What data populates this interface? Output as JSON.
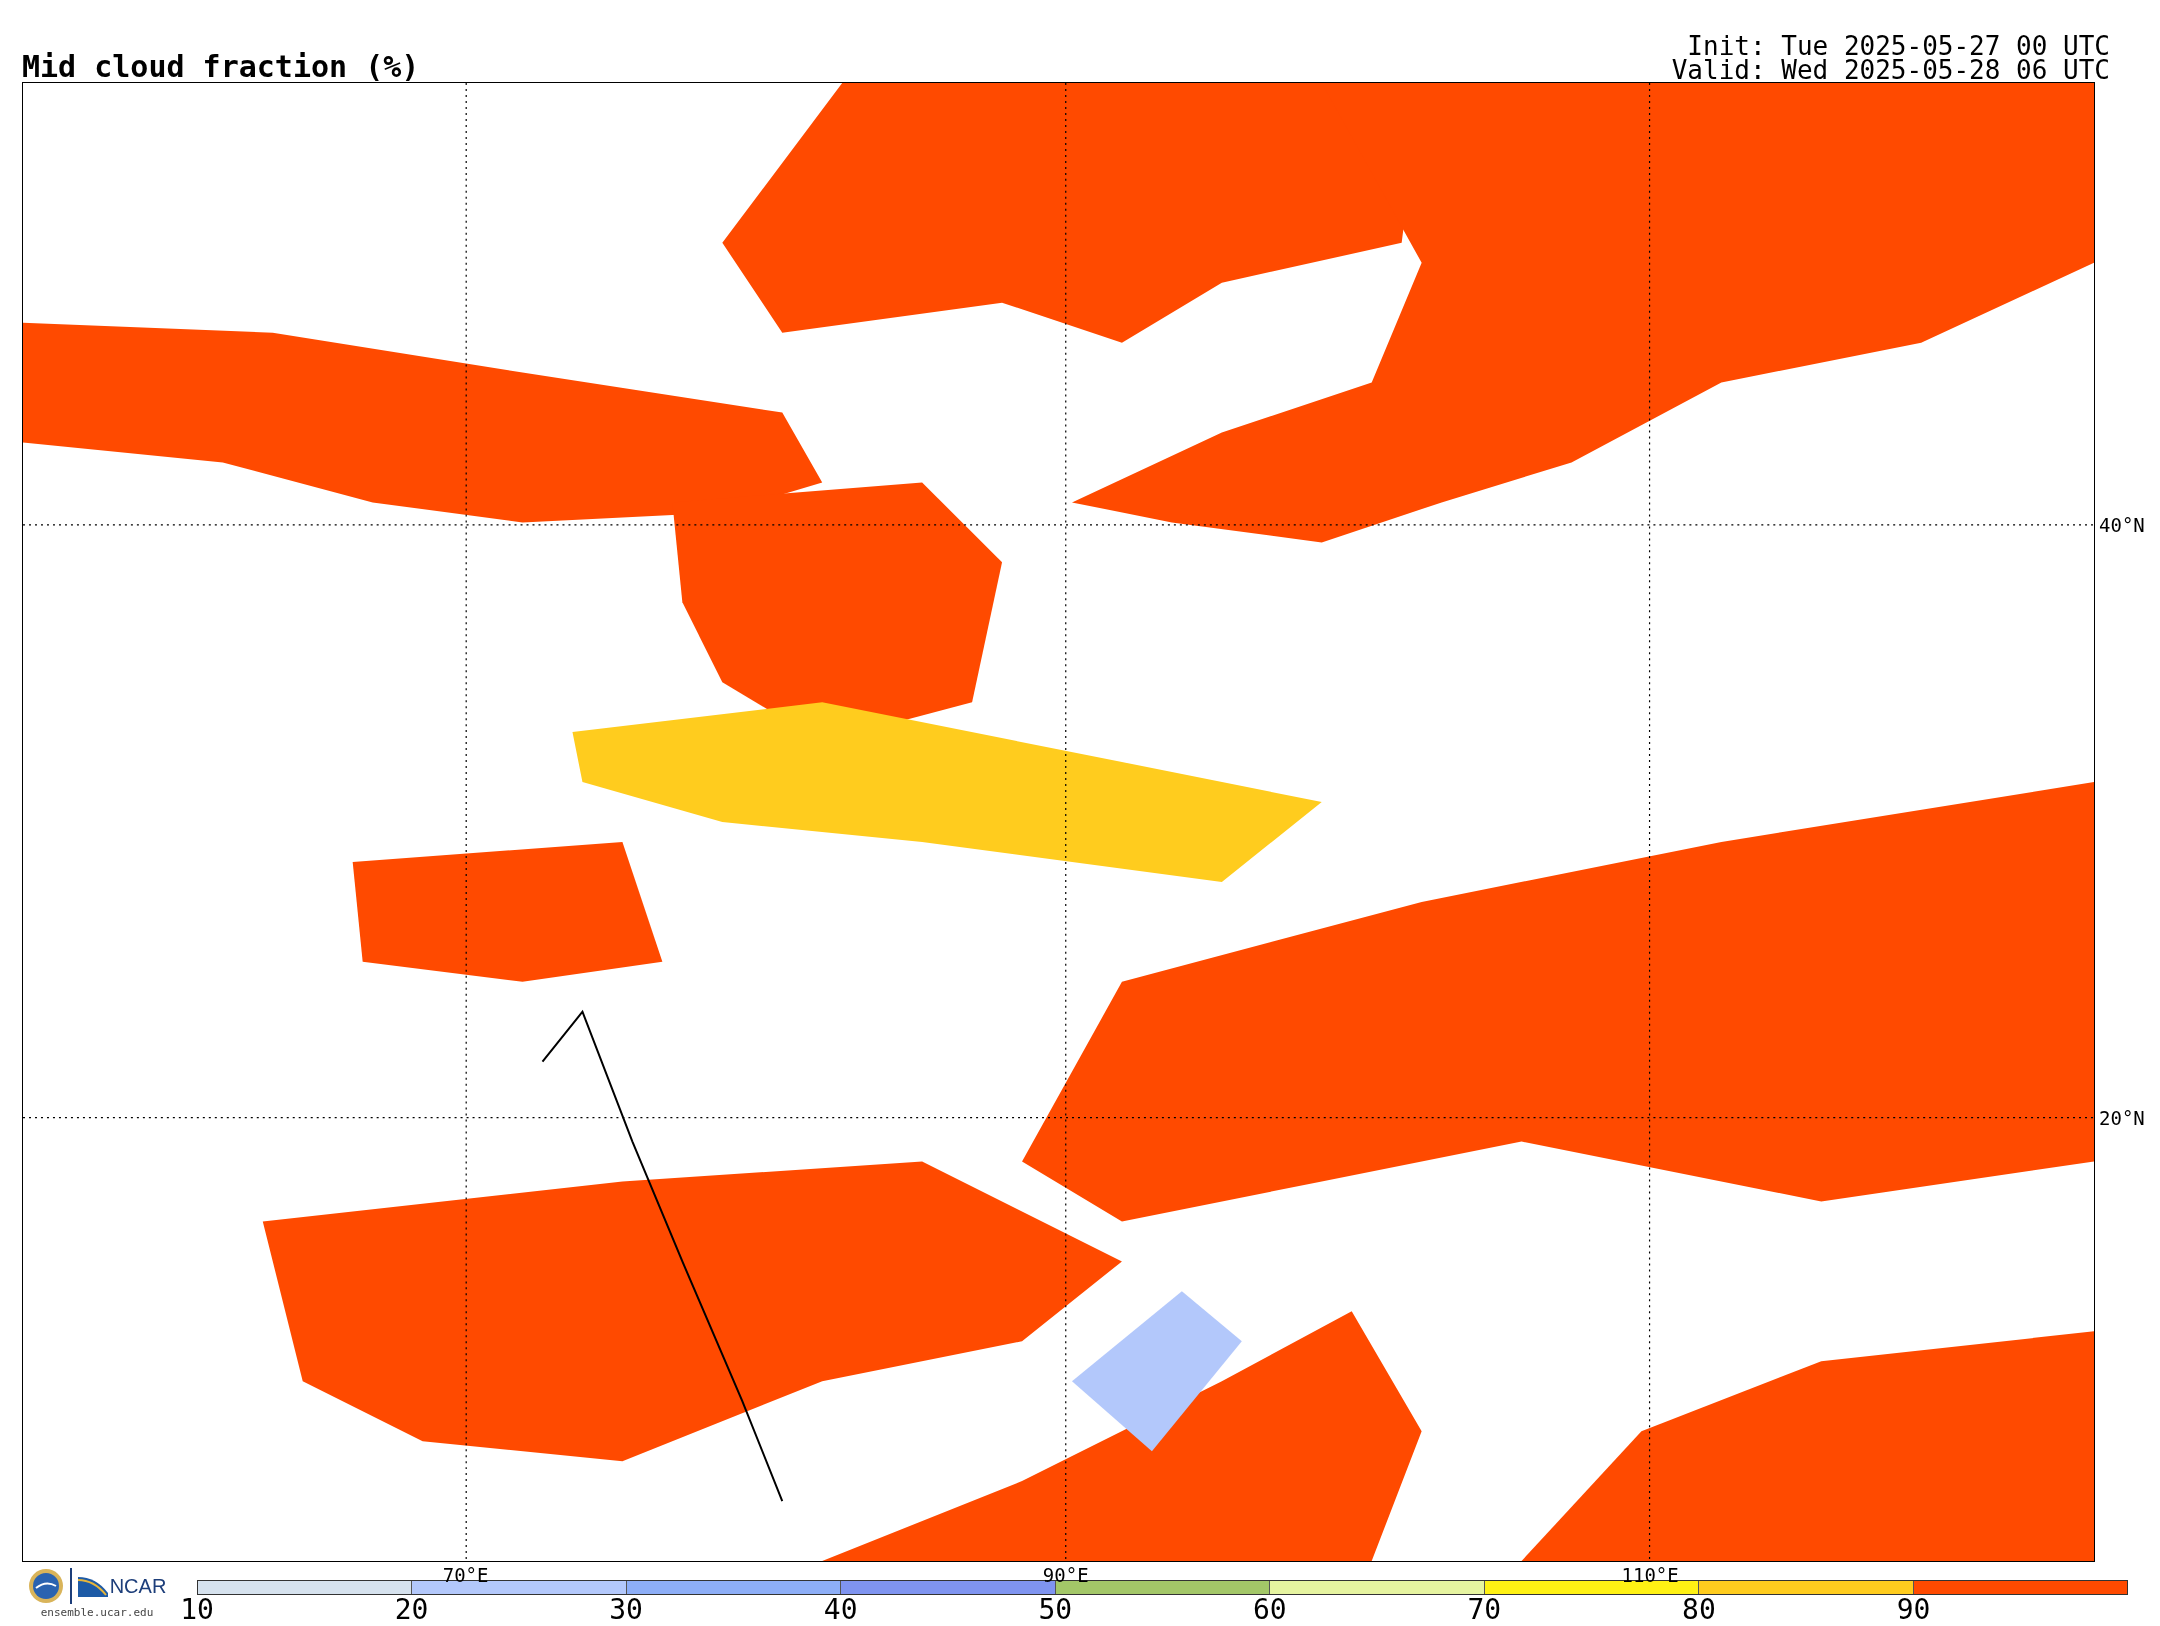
{
  "title": "Mid cloud fraction (%)",
  "init": "Init: Tue 2025-05-27 00 UTC",
  "valid": "Valid: Wed 2025-05-28 06 UTC",
  "map": {
    "lon_labels": [
      "70°E",
      "90°E",
      "110°E"
    ],
    "lat_labels": [
      "40°N",
      "20°N"
    ]
  },
  "logos": {
    "ncar": "NCAR",
    "url": "ensemble.ucar.edu"
  },
  "colorbar": {
    "bins": [
      {
        "color": "#d6e2ee"
      },
      {
        "color": "#b3c8fb"
      },
      {
        "color": "#8daef7"
      },
      {
        "color": "#7f94f0"
      },
      {
        "color": "#a3c768"
      },
      {
        "color": "#e6f4a0"
      },
      {
        "color": "#fff114"
      },
      {
        "color": "#ffcc1e"
      },
      {
        "color": "#ff4a00"
      }
    ],
    "labels": [
      "10",
      "20",
      "30",
      "40",
      "50",
      "60",
      "70",
      "80",
      "90"
    ]
  }
}
